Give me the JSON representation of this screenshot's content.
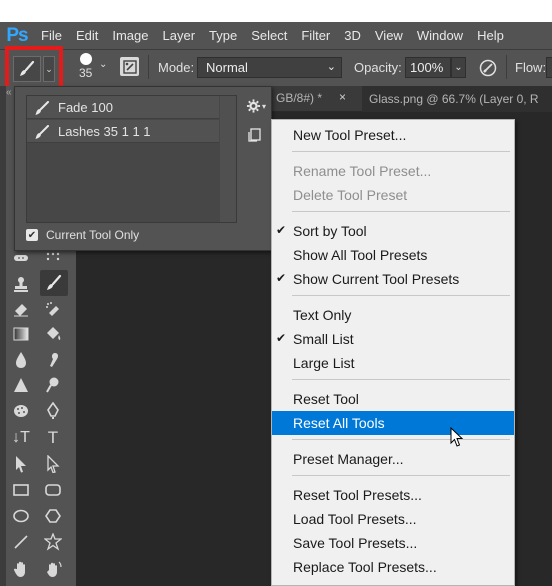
{
  "app": {
    "logo": "Ps"
  },
  "menubar": {
    "items": [
      "File",
      "Edit",
      "Image",
      "Layer",
      "Type",
      "Select",
      "Filter",
      "3D",
      "View",
      "Window",
      "Help"
    ]
  },
  "options": {
    "brush_size": "35",
    "mode_label": "Mode:",
    "mode_value": "Normal",
    "opacity_label": "Opacity:",
    "opacity_value": "100%",
    "flow_label": "Flow:"
  },
  "tabs": {
    "partial_tab": "GB/8#) *",
    "partial_close": "×",
    "glass_tab": "Glass.png @ 66.7% (Layer 0, R"
  },
  "tool_presets": {
    "items": [
      {
        "label": "Fade 100"
      },
      {
        "label": "Lashes 35 1 1 1"
      }
    ],
    "current_tool_only_label": "Current Tool Only",
    "current_tool_only_checked": true
  },
  "context_menu": {
    "items": [
      {
        "label": "New Tool Preset...",
        "disabled": false,
        "checked": false,
        "highlighted": false
      },
      {
        "label": "Rename Tool Preset...",
        "disabled": true,
        "checked": false,
        "highlighted": false
      },
      {
        "label": "Delete Tool Preset",
        "disabled": true,
        "checked": false,
        "highlighted": false
      },
      {
        "label": "Sort by Tool",
        "disabled": false,
        "checked": true,
        "highlighted": false
      },
      {
        "label": "Show All Tool Presets",
        "disabled": false,
        "checked": false,
        "highlighted": false
      },
      {
        "label": "Show Current Tool Presets",
        "disabled": false,
        "checked": true,
        "highlighted": false
      },
      {
        "label": "Text Only",
        "disabled": false,
        "checked": false,
        "highlighted": false
      },
      {
        "label": "Small List",
        "disabled": false,
        "checked": true,
        "highlighted": false
      },
      {
        "label": "Large List",
        "disabled": false,
        "checked": false,
        "highlighted": false
      },
      {
        "label": "Reset Tool",
        "disabled": false,
        "checked": false,
        "highlighted": false
      },
      {
        "label": "Reset All Tools",
        "disabled": false,
        "checked": false,
        "highlighted": true
      },
      {
        "label": "Preset Manager...",
        "disabled": false,
        "checked": false,
        "highlighted": false
      },
      {
        "label": "Reset Tool Presets...",
        "disabled": false,
        "checked": false,
        "highlighted": false
      },
      {
        "label": "Load Tool Presets...",
        "disabled": false,
        "checked": false,
        "highlighted": false
      },
      {
        "label": "Save Tool Presets...",
        "disabled": false,
        "checked": false,
        "highlighted": false
      },
      {
        "label": "Replace Tool Presets...",
        "disabled": false,
        "checked": false,
        "highlighted": false
      }
    ]
  },
  "toolbar": {
    "tools": [
      "spot-healing-icon",
      "brush-icon",
      "clone-stamp-icon",
      "history-brush-icon",
      "eraser-icon",
      "paint-bucket-icon",
      "gradient-icon",
      "blur-icon",
      "dodge-icon",
      "smudge-icon",
      "sharpen-icon",
      "sponge-icon",
      "sponge-dots-icon",
      "pen-icon",
      "vertical-type-icon",
      "type-icon",
      "path-selection-icon",
      "direct-selection-icon",
      "rectangle-icon",
      "rounded-rectangle-icon",
      "ellipse-icon",
      "polygon-icon",
      "line-icon",
      "custom-shape-icon",
      "hand-icon",
      "rotate-view-icon"
    ],
    "type_glyph": "T",
    "vtype_glyph": "↓T"
  },
  "colors": {
    "accent_highlight": "#0078d7",
    "annotation_red": "#e31b1b",
    "ps_blue": "#31a8ff"
  }
}
